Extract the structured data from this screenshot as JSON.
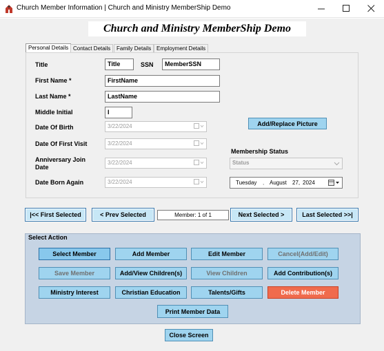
{
  "window": {
    "title": "Church Member Information | Church and Ministry MemberShip Demo"
  },
  "banner": "Church and Ministry MemberShip Demo",
  "tabs": [
    {
      "label": "Personal Details"
    },
    {
      "label": "Contact Details"
    },
    {
      "label": "Family Details"
    },
    {
      "label": "Employment Details"
    }
  ],
  "form": {
    "title_label": "Title",
    "title_value": "Title",
    "ssn_label": "SSN",
    "ssn_value": "MemberSSN",
    "first_name_label": "First Name *",
    "first_name_value": "FirstName",
    "last_name_label": "Last Name *",
    "last_name_value": "LastName",
    "middle_initial_label": "Middle Initial",
    "middle_initial_value": "I",
    "dob_label": "Date Of Birth",
    "dob_value": "3/22/2024",
    "first_visit_label": "Date Of  First  Visit",
    "first_visit_value": "3/22/2024",
    "anniversary_label_1": "Anniversary Join",
    "anniversary_label_2": "Date",
    "anniversary_value": "3/22/2024",
    "born_again_label": "Date Born Again",
    "born_again_value": "3/22/2024",
    "picture_button": "Add/Replace Picture",
    "membership_status_label": "Membership Status",
    "membership_status_value": "Status",
    "membership_date": {
      "weekday": "Tuesday",
      "month": "August",
      "day": "27,",
      "year": "2024"
    }
  },
  "navigation": {
    "first": "|<< First Selected",
    "prev": "< Prev Selected",
    "counter": "Member: 1 of 1",
    "next": "Next Selected >",
    "last": "Last Selected >>|"
  },
  "actions": {
    "group_label": "Select Action",
    "select_member": "Select  Member",
    "add_member": "Add Member",
    "edit_member": "Edit Member",
    "cancel": "Cancel(Add/Edit)",
    "save_member": "Save Member",
    "add_view_children": "Add/View Children(s)",
    "view_children": "View Children",
    "add_contributions": "Add Contribution(s)",
    "ministry_interest": "Ministry Interest",
    "christian_education": "Christian Education",
    "talents_gifts": "Talents/Gifts",
    "delete_member": "Delete Member",
    "print_member_data": "Print Member Data"
  },
  "close_screen": "Close Screen",
  "icons": {
    "app": "church-icon",
    "minimize": "minimize-icon",
    "maximize": "maximize-icon",
    "close": "close-icon"
  },
  "colors": {
    "button_blue": "#9fd4ef",
    "nav_blue": "#c7e7f6",
    "panel": "#c6d4e4",
    "delete_red": "#f06b4d"
  }
}
